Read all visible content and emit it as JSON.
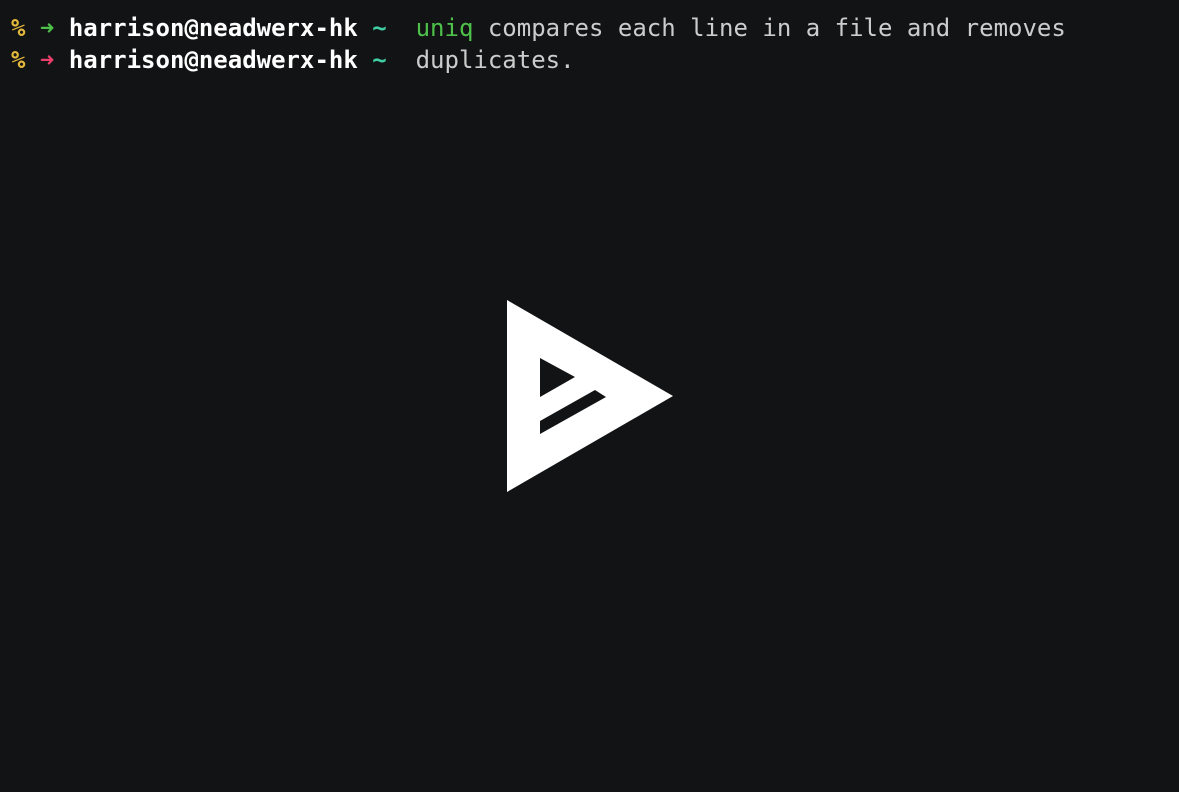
{
  "terminal": {
    "lines": [
      {
        "prompt_symbol": "%",
        "arrow": "➜",
        "arrow_status": "success",
        "user_host": "harrison@neadwerx-hk",
        "cwd": "~",
        "command": "uniq",
        "text": " compares each line in a file and removes"
      },
      {
        "prompt_symbol": "%",
        "arrow": "➜",
        "arrow_status": "error",
        "user_host": "harrison@neadwerx-hk",
        "cwd": "~",
        "command": "",
        "text": "duplicates."
      }
    ]
  },
  "player": {
    "icon": "asciinema-play-icon",
    "icon_color": "#ffffff"
  },
  "colors": {
    "background": "#121314",
    "prompt_percent": "#e2b93d",
    "arrow_success": "#4ec14b",
    "arrow_error": "#e8406a",
    "user_host": "#ffffff",
    "tilde": "#3fcfa3",
    "command": "#4ec14b",
    "text": "#cccccc"
  }
}
